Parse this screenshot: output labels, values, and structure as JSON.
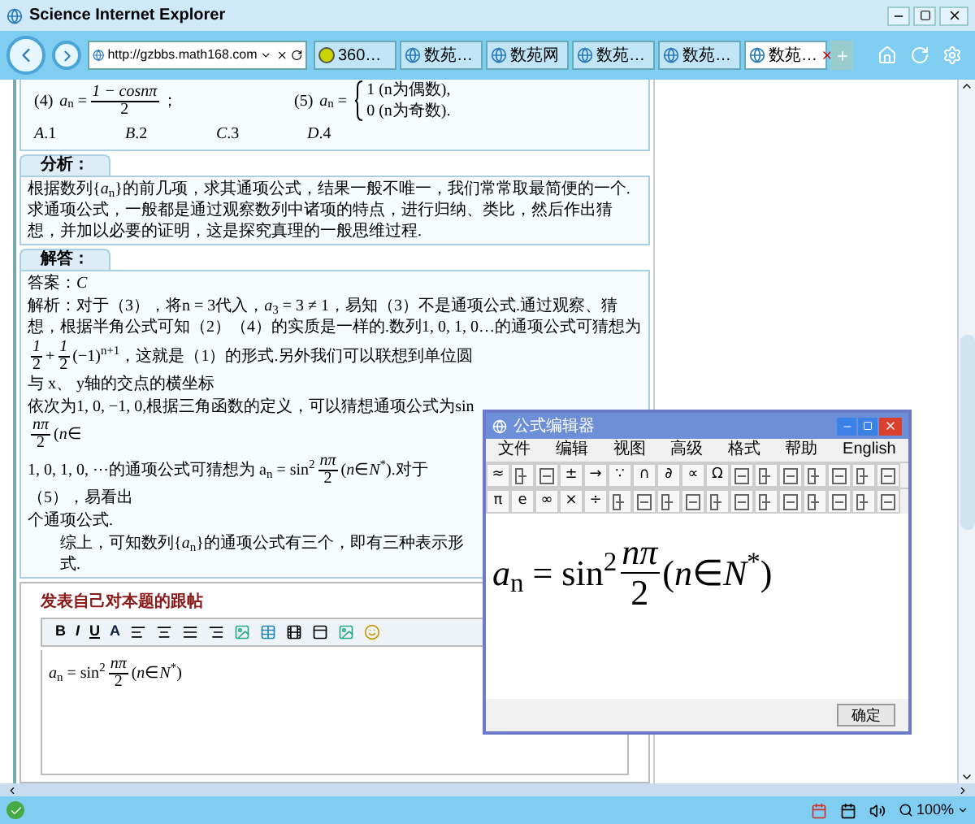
{
  "window": {
    "title": "Science Internet Explorer"
  },
  "address_bar": {
    "url": "http://gzbbs.math168.com"
  },
  "tabs": [
    {
      "label": "360…",
      "selected": false,
      "kind": "round"
    },
    {
      "label": "数苑…",
      "selected": false,
      "kind": "page"
    },
    {
      "label": "数苑网",
      "selected": false,
      "kind": "page"
    },
    {
      "label": "数苑…",
      "selected": false,
      "kind": "page"
    },
    {
      "label": "数苑…",
      "selected": false,
      "kind": "page"
    },
    {
      "label": "数苑…",
      "selected": true,
      "kind": "page"
    }
  ],
  "question": {
    "items": [
      {
        "label": "(4)",
        "formula": [
          {
            "kind": "text",
            "text": "*a*$_{n}$ ="
          },
          {
            "kind": "frac",
            "num": "1 − cosnπ",
            "den": "2"
          },
          {
            "kind": "text",
            "text": "；"
          }
        ]
      },
      {
        "label": "(5)",
        "formula": [
          {
            "kind": "text",
            "text": "*a*$_{n}$ ="
          },
          {
            "kind": "cases",
            "lines": [
              "1 (n为偶数),",
              "0 (n为奇数)."
            ]
          }
        ]
      }
    ],
    "choices": [
      "*A*.1",
      "*B*.2",
      "*C*.3",
      "*D*.4"
    ]
  },
  "analysis": {
    "heading": "分析：",
    "text": "根据数列{*a*$_{n}$}的前几项，求其通项公式，结果一般不唯一，我们常常取最简便的一个.求通项公式，一般都是通过观察数列中诸项的特点，进行归纳、类比，然后作出猜想，并加以必要的证明，这是探究真理的一般思维过程."
  },
  "answer": {
    "heading": "解答：",
    "lines": [
      {
        "kind": "plain",
        "parts": [
          {
            "kind": "text",
            "text": "答案：*C*"
          }
        ]
      },
      {
        "kind": "plain",
        "parts": [
          {
            "kind": "text",
            "text": "解析：对于（3），将n = 3代入，*a*$_{3}$ = 3 ≠ 1，易知（3）不是通项公式.通过观察、猜想，根据半角公式可知（2）（4）的实质是一样的.数列1, 0, 1, 0…的通项公式可猜想为"
          }
        ]
      },
      {
        "kind": "plain",
        "parts": [
          {
            "kind": "frac",
            "num": "1",
            "den": "2"
          },
          {
            "kind": "text",
            "text": "+"
          },
          {
            "kind": "frac",
            "num": "1",
            "den": "2"
          },
          {
            "kind": "text",
            "text": "(−1)$^{n+1}$，这就是（1）的形式.另外我们可以联想到单位圆与 x、 y轴的交点的横坐标"
          }
        ]
      },
      {
        "kind": "plain",
        "parts": [
          {
            "kind": "text",
            "text": "依次为1, 0, −1, 0,根据三角函数的定义，可以猜想通项公式为sin"
          },
          {
            "kind": "frac",
            "num": "nπ",
            "den": "2"
          },
          {
            "kind": "text",
            "text": "(*n*∈"
          }
        ]
      },
      {
        "kind": "plain",
        "parts": [
          {
            "kind": "text",
            "text": "1, 0, 1, 0, ⋯的通项公式可猜想为 a$_{n}$ = sin$^{2}$"
          },
          {
            "kind": "frac",
            "num": "nπ",
            "den": "2"
          },
          {
            "kind": "text",
            "text": "(*n*∈*N*$^{*}$).对于（5），易看出"
          }
        ]
      },
      {
        "kind": "plain",
        "parts": [
          {
            "kind": "text",
            "text": "个通项公式."
          }
        ]
      },
      {
        "kind": "indented",
        "parts": [
          {
            "kind": "text",
            "text": "综上，可知数列{*a*$_{n}$}的通项公式有三个，即有三种表示形式."
          }
        ]
      }
    ]
  },
  "reply": {
    "heading": "发表自己对本题的跟帖",
    "format_buttons": [
      "B",
      "I",
      "U",
      "A"
    ],
    "content": [
      {
        "kind": "text",
        "text": "*a*$_{n}$ = sin$^{2}$"
      },
      {
        "kind": "frac",
        "num": "nπ",
        "den": "2"
      },
      {
        "kind": "text",
        "text": "(*n*∈*N*$^{*}$)"
      }
    ]
  },
  "formula_editor": {
    "title": "公式编辑器",
    "menus": [
      "文件",
      "编辑",
      "视图",
      "高级",
      "格式",
      "帮助",
      "English"
    ],
    "symbol_rows": [
      [
        {
          "kind": "char",
          "text": "≈"
        },
        {
          "kind": "icon"
        },
        {
          "kind": "icon"
        },
        {
          "kind": "char",
          "text": "±"
        },
        {
          "kind": "char",
          "text": "→"
        },
        {
          "kind": "char",
          "text": "∵"
        },
        {
          "kind": "char",
          "text": "∩"
        },
        {
          "kind": "char",
          "text": "∂"
        },
        {
          "kind": "char",
          "text": "∝"
        },
        {
          "kind": "char",
          "text": "Ω"
        },
        {
          "kind": "icon"
        },
        {
          "kind": "icon"
        },
        {
          "kind": "icon"
        },
        {
          "kind": "icon"
        },
        {
          "kind": "icon"
        },
        {
          "kind": "icon"
        },
        {
          "kind": "icon"
        }
      ],
      [
        {
          "kind": "char",
          "text": "π"
        },
        {
          "kind": "char",
          "text": "e"
        },
        {
          "kind": "char",
          "text": "∞"
        },
        {
          "kind": "char",
          "text": "×"
        },
        {
          "kind": "char",
          "text": "÷"
        },
        {
          "kind": "icon"
        },
        {
          "kind": "icon"
        },
        {
          "kind": "icon"
        },
        {
          "kind": "icon"
        },
        {
          "kind": "icon"
        },
        {
          "kind": "icon"
        },
        {
          "kind": "icon"
        },
        {
          "kind": "icon"
        },
        {
          "kind": "icon"
        },
        {
          "kind": "icon"
        },
        {
          "kind": "icon"
        },
        {
          "kind": "icon"
        }
      ]
    ],
    "formula": [
      {
        "kind": "text",
        "text": "*a*$_{n}$ = sin$^{2}$"
      },
      {
        "kind": "frac",
        "num": "nπ",
        "den": "2"
      },
      {
        "kind": "text",
        "text": "(*n*∈*N*$^{*}$)"
      }
    ],
    "ok_button": "确定"
  },
  "status_bar": {
    "zoom": "100%"
  }
}
